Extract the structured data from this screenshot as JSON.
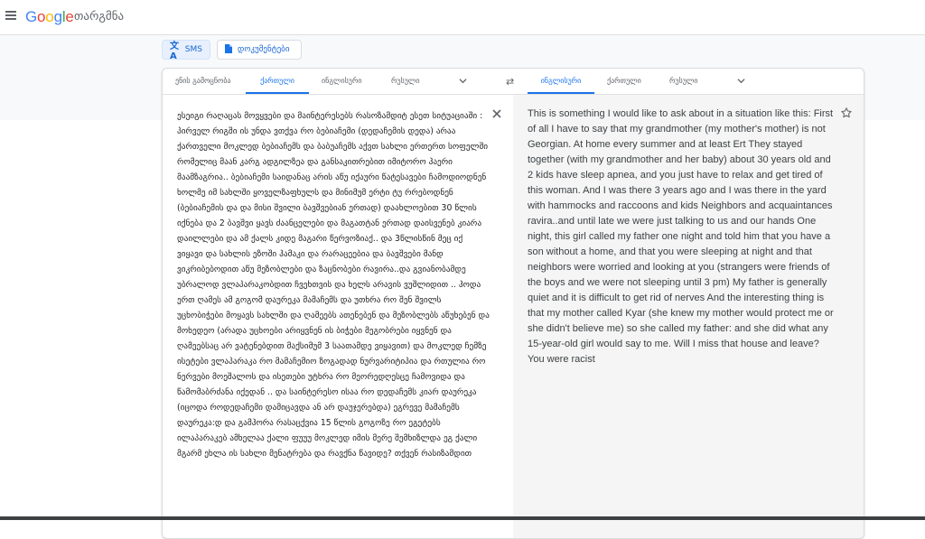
{
  "header": {
    "logo_text": "Google",
    "product_name": "თარგმნა"
  },
  "modes": [
    {
      "label": "SMS",
      "icon": "translate-icon",
      "active": true
    },
    {
      "label": "დოკუმენტები",
      "icon": "document-icon",
      "active": false
    }
  ],
  "source_langs": [
    {
      "label": "ენის გამოცნობა",
      "active": false
    },
    {
      "label": "ქართული",
      "active": true
    },
    {
      "label": "ინგლისური",
      "active": false
    },
    {
      "label": "რუსული",
      "active": false
    }
  ],
  "target_langs": [
    {
      "label": "ინგლისური",
      "active": true
    },
    {
      "label": "ქართული",
      "active": false
    },
    {
      "label": "რუსული",
      "active": false
    }
  ],
  "source_text": "ესეიგი რაღაცას მოვყვები და მაინტერესებს რასოზამდიტ ესეთ სიტუაციაში : პირველ რიგში ის უნდა ვთქვა რო ბებიაჩემი (დედაჩემის დედა) არაა ქართველი მოკლედ ბებიაჩემს და ბაბუაჩემს აქვთ სახლი ერთერთ სოფელში რომელიც მაან კარგ ადგილზეა და განსაკითრებით იმიტორო ჰაერი მაამზაგრია.. ბებიაჩემი საიდანაც არის აწუ იქაური წატესავები ჩამოდიოდნენ ხოლმე იმ სახლში ყოველზაფხულს და მინიმუმ ერტი ტუ რრებოდნენ (ბებიაჩემის და და მისი შვილი ბავშვებიან ერთად) დაახლოებით 30 წლის იქნება და 2 ბავშვი ყავს ძაანცელები და მაგათტან ერთად დაისვენებ კიარა დაილლები და ამ ქალს კიდე მაგარი წერვოზიაქ.. და 3წლისწინ მეც იქ ვიყავი და სახლის ეზოში ჰამაკი და რარაცეებია და ბავშვები მანდ ვიკრიბებოდით აწუ მეზობლები და ზაცნობები რავირა..და გვიანობამდე უბრალოდ ვლაპარაკობდით ჩვეხთვის და ხელს არავის ვუშლიდით .. ჰოდა ერთ ღამეს ამ გოგომ დაურეკა მამაჩემს და უთხრა რო შენ შვილს უცხობიჭები მოყავს სახლში და ღამეებს ათენებენ და მეზობლებს აწუხებენ და მოხედეო (არადა უცხოები არიყვნენ ის ბიჭები მეგობრები იყვნენ და ღამეებსაც არ ვატენებდით მაქსიმუმ 3 საათამდე ვიყავით) და მოკლედ ჩემზე ისეტები ვლაპარაკა რო მამაჩემიო ზოგადად ნურვარიტიპია და რთულია რო ნერვები მოეშალოს და ისეთები უტხრა რო მეორედღესცე ჩამოვიდა და წამომაბრძანა იქედან .. და საინტერესო ისაა რო დედაჩემს კიარ დაურეკა (იცოდა როდედაჩემი დამიცავდა ან არ დაუჯერებდა) ეგრევე მამაჩემს დაურეკა:დ და გამჰორა რასაცქვია 15 წლის გოგოზე რო ეგეტებს ილაპარაკებ ამხელაა ქალი ფუუუ მოკლედ იმის მერე შემხიზლდა ეგ ქალი მგარმ ეხლა ის სახლი მენატრება და რავქნა წავიდე? თქვენ რასიზამდით",
  "target_text": "This is something I would like to ask about in a situation like this: First of all I have to say that my grandmother (my mother's mother) is not Georgian. At home every summer and at least Ert They stayed together (with my grandmother and her baby) about 30 years old and 2 kids have sleep apnea, and you just have to relax and get tired of this woman. And I was there 3 years ago and I was there in the yard with hammocks and raccoons and kids Neighbors and acquaintances ravira..and until late we were just talking to us and our hands One night, this girl called my father one night and told him that you have a son without a home, and that you were sleeping at night and that neighbors were worried and looking at you (strangers were friends of the boys and we were not sleeping until 3 pm) My father is generally quiet and it is difficult to get rid of nerves And the interesting thing is that my mother called Kyar (she knew my mother would protect me or she didn't believe me) so she called my father: and she did what any 15-year-old girl would say to me. Will I miss that house and leave? You were racist"
}
